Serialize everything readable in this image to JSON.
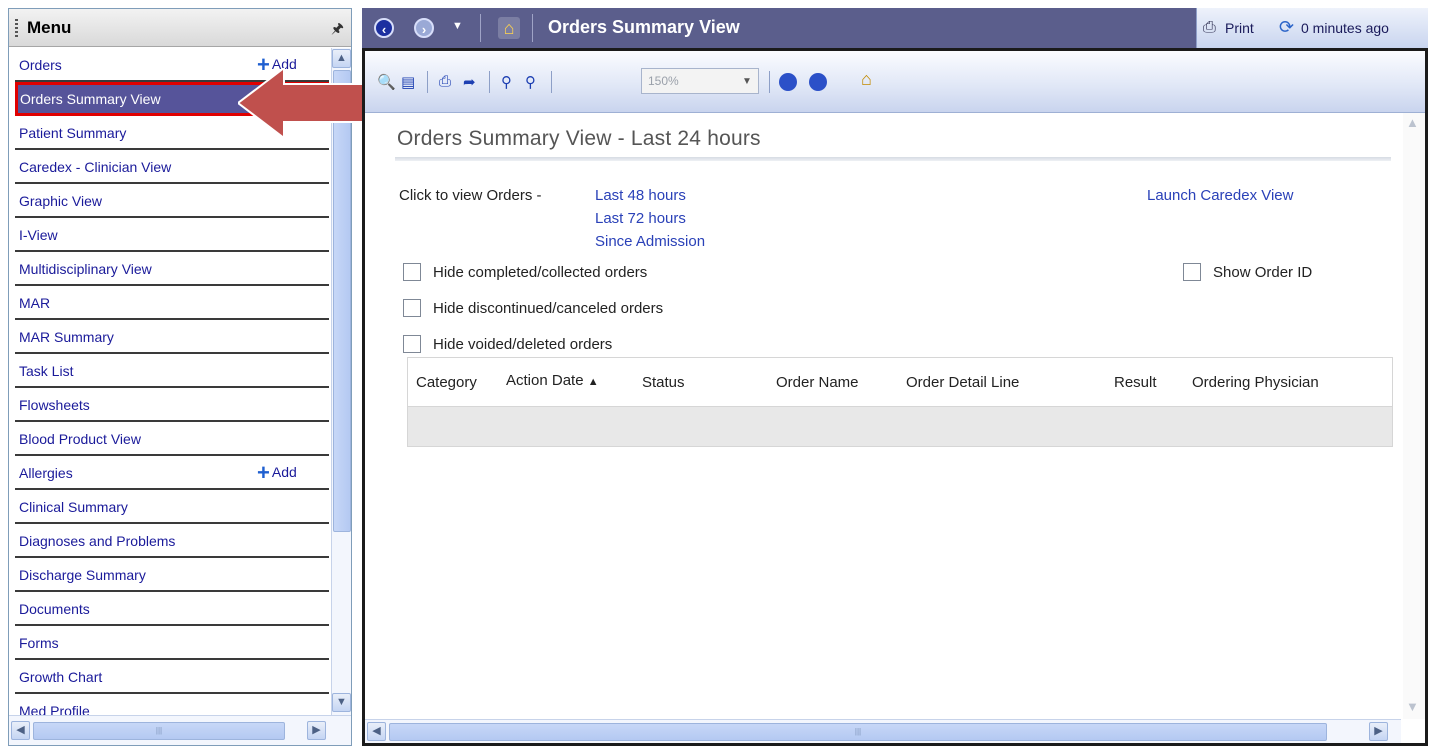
{
  "menu": {
    "title": "Menu",
    "pin_glyph": "⁘",
    "add_label": "Add",
    "items": [
      {
        "label": "Orders"
      },
      {
        "label": "Orders Summary View"
      },
      {
        "label": "Patient Summary"
      },
      {
        "label": "Caredex - Clinician View"
      },
      {
        "label": "Graphic View"
      },
      {
        "label": "I-View"
      },
      {
        "label": "Multidisciplinary View"
      },
      {
        "label": "MAR"
      },
      {
        "label": "MAR Summary"
      },
      {
        "label": "Task List"
      },
      {
        "label": "Flowsheets"
      },
      {
        "label": "Blood Product View"
      },
      {
        "label": "Allergies"
      },
      {
        "label": "Clinical Summary"
      },
      {
        "label": "Diagnoses and Problems"
      },
      {
        "label": "Discharge Summary"
      },
      {
        "label": "Documents"
      },
      {
        "label": "Forms"
      },
      {
        "label": "Growth Chart"
      },
      {
        "label": "Med Profile"
      }
    ],
    "selected_item": "Orders Summary View"
  },
  "topbar": {
    "title": "Orders Summary View",
    "print_label": "Print",
    "refresh_label": "0 minutes ago"
  },
  "toolbar": {
    "zoom_value": "150%"
  },
  "content": {
    "page_title": "Orders Summary View - Last 24 hours",
    "click_label": "Click to view Orders -",
    "links": {
      "last48": "Last 48 hours",
      "last72": "Last 72 hours",
      "since_admission": "Since Admission",
      "launch_caredex": "Launch Caredex View"
    },
    "filters": {
      "hide_completed": "Hide completed/collected orders",
      "hide_discontinued": "Hide discontinued/canceled orders",
      "hide_voided": "Hide voided/deleted orders",
      "show_order_id": "Show Order ID"
    },
    "grid": {
      "columns": [
        "Category",
        "Action Date",
        "Status",
        "Order Name",
        "Order Detail Line",
        "Result",
        "Ordering Physician"
      ],
      "sort_indicator": "▲",
      "rows": []
    }
  },
  "colors": {
    "header_bar": "#5b5e8c",
    "selected_item_bg": "#56549a",
    "highlight_border": "#e00000",
    "arrow": "#c0504d",
    "link": "#2a41b8"
  }
}
